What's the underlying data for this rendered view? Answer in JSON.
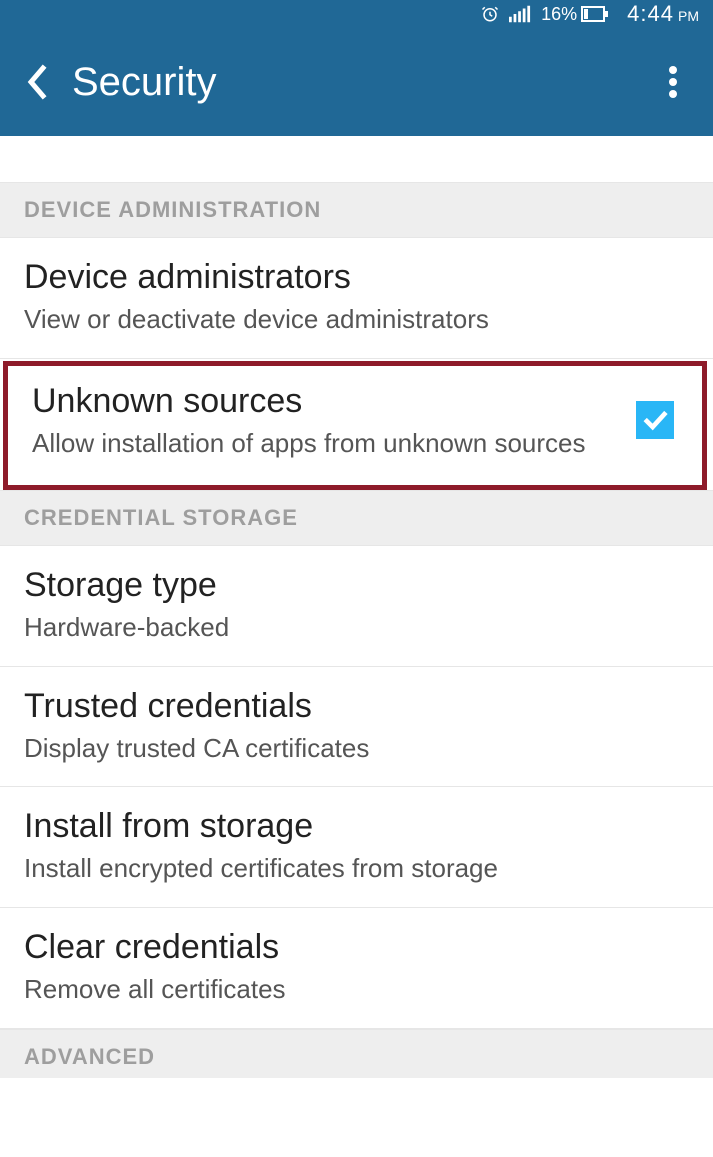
{
  "status_bar": {
    "battery_pct": "16%",
    "time_hm": "4:44",
    "time_ampm": "PM"
  },
  "app_bar": {
    "title": "Security"
  },
  "sections": {
    "device_admin": {
      "header": "DEVICE ADMINISTRATION"
    },
    "credential_storage": {
      "header": "CREDENTIAL STORAGE"
    },
    "advanced": {
      "header": "ADVANCED"
    }
  },
  "items": {
    "device_admins": {
      "title": "Device administrators",
      "sub": "View or deactivate device administrators"
    },
    "unknown_sources": {
      "title": "Unknown sources",
      "sub": "Allow installation of apps from unknown sources",
      "checked": true
    },
    "storage_type": {
      "title": "Storage type",
      "sub": "Hardware-backed"
    },
    "trusted_credentials": {
      "title": "Trusted credentials",
      "sub": "Display trusted CA certificates"
    },
    "install_from_storage": {
      "title": "Install from storage",
      "sub": "Install encrypted certificates from storage"
    },
    "clear_credentials": {
      "title": "Clear credentials",
      "sub": "Remove all certificates"
    }
  }
}
